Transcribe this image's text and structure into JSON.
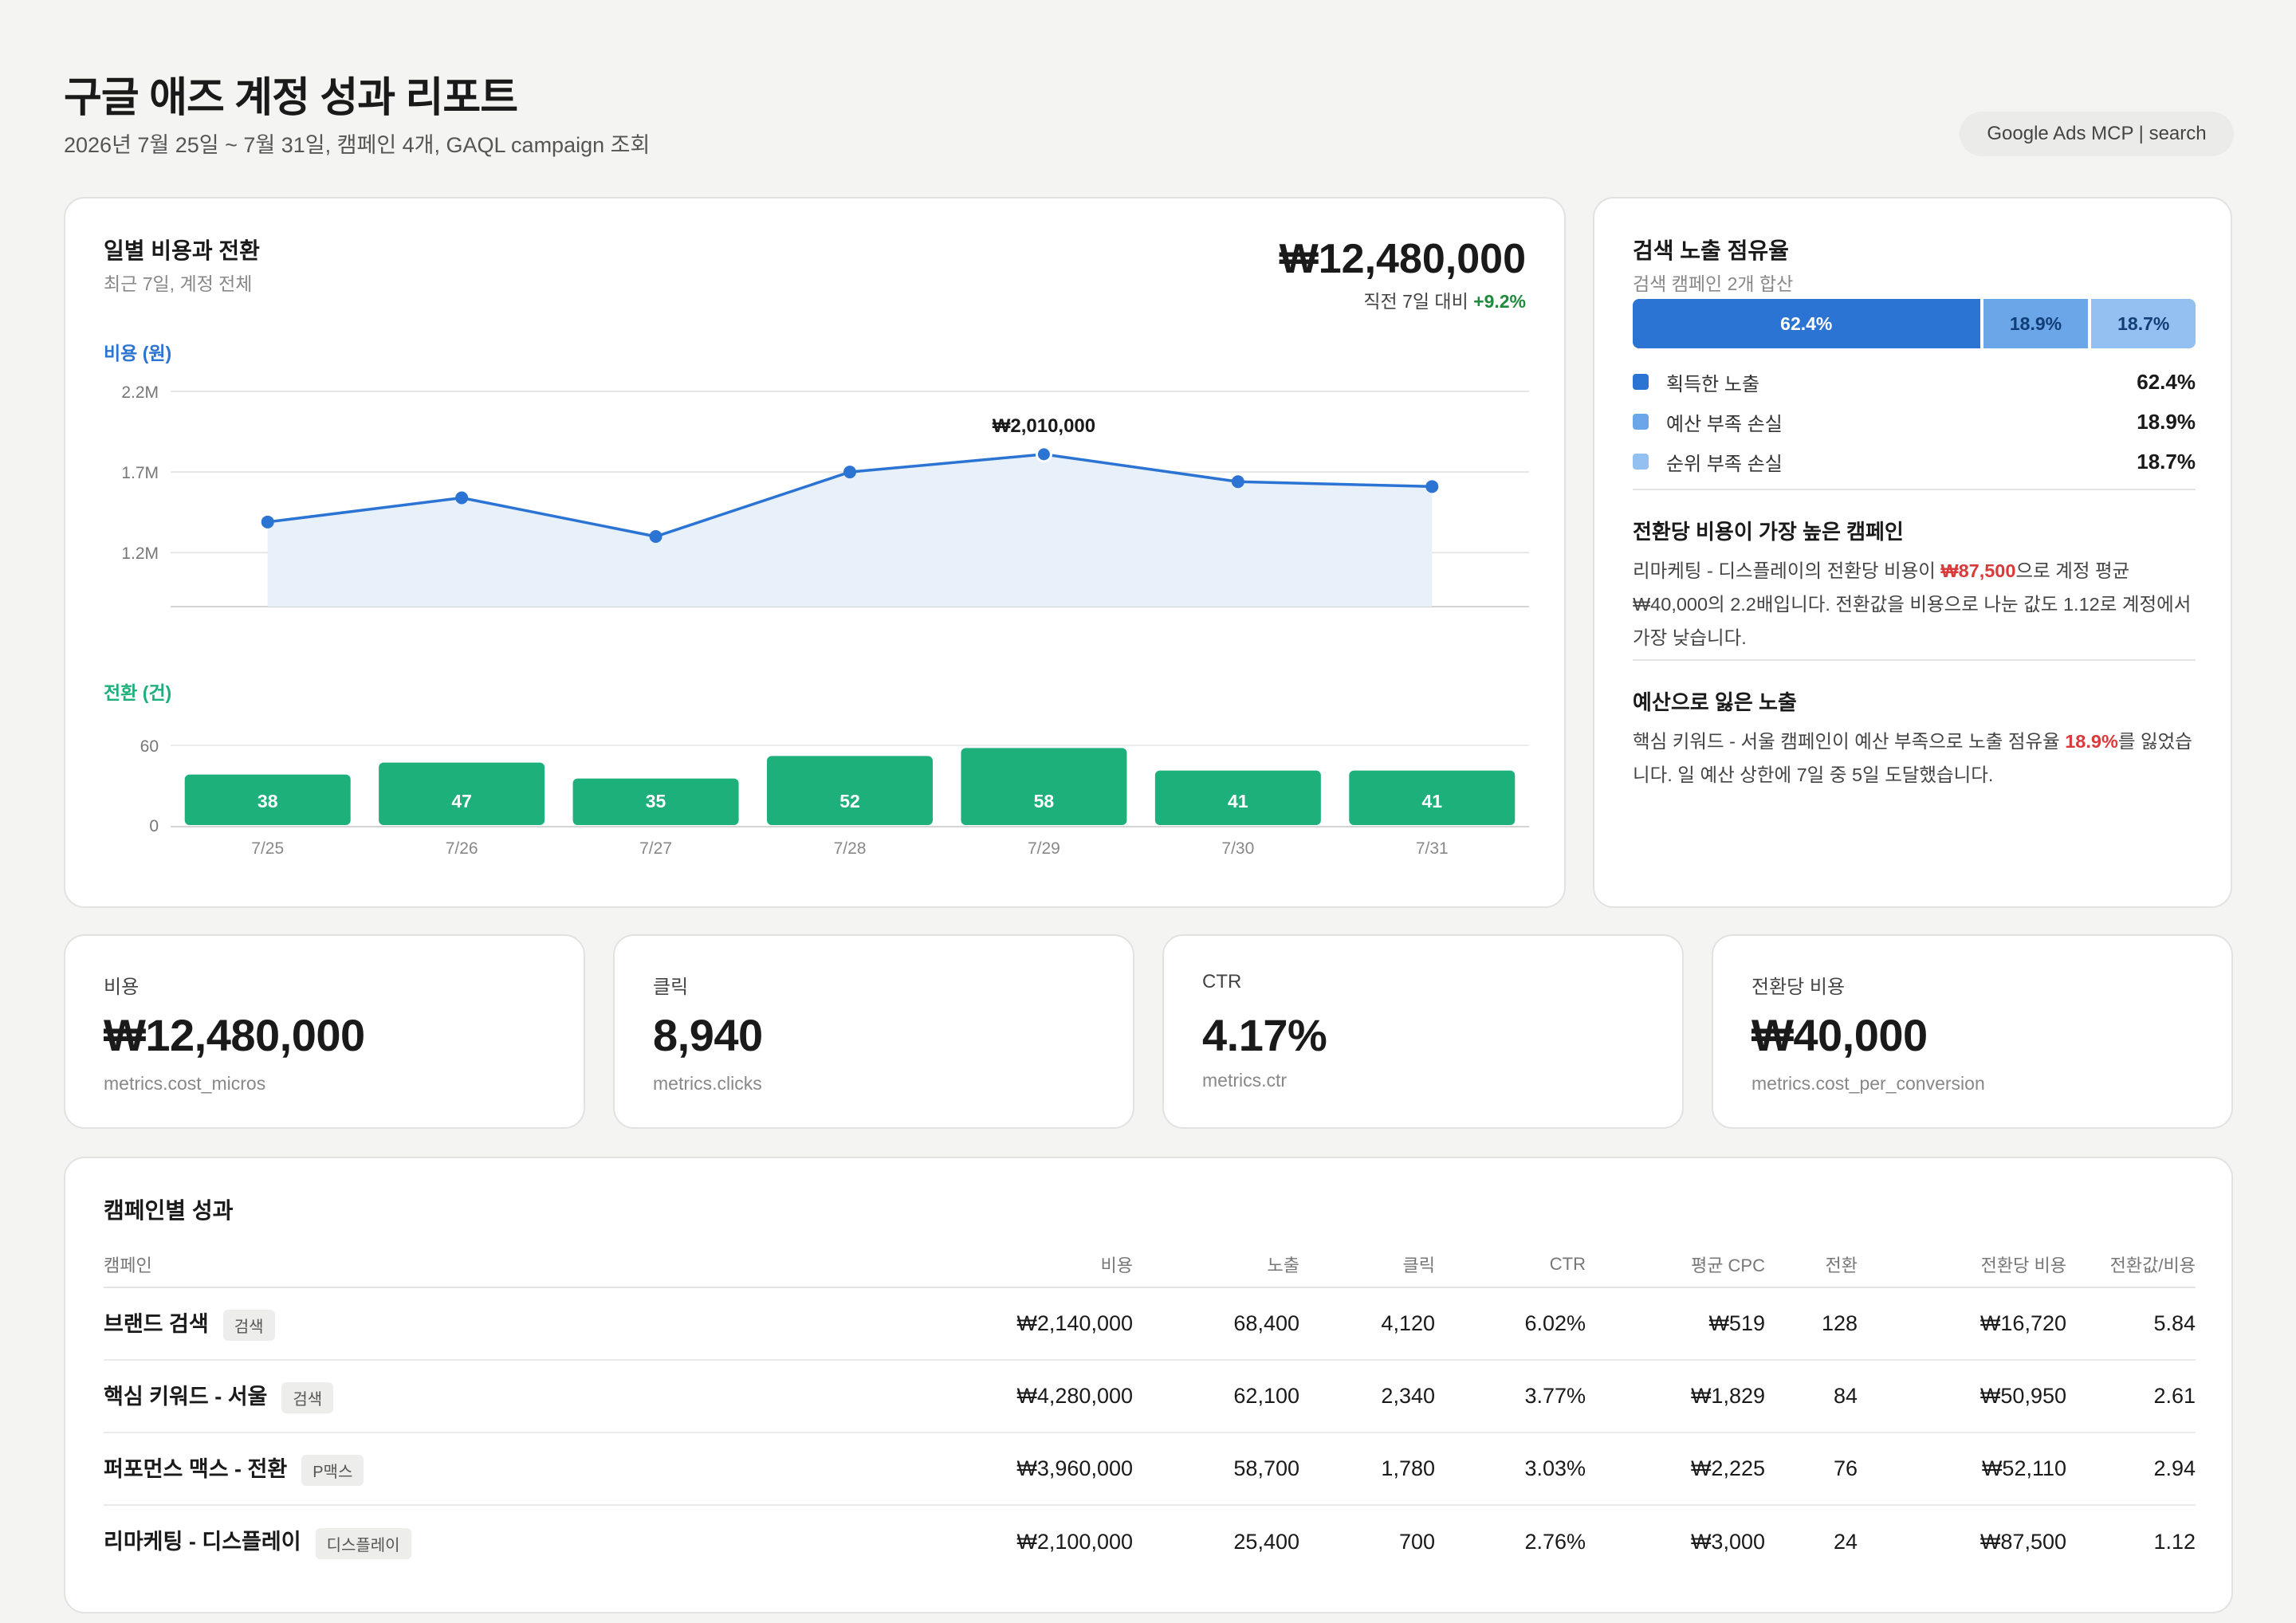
{
  "header": {
    "title": "구글 애즈 계정 성과 리포트",
    "subtitle": "2026년 7월 25일 ~ 7월 31일, 캠페인 4개, GAQL campaign 조회",
    "source": "Google Ads MCP | search"
  },
  "daily": {
    "title": "일별 비용과 전환",
    "subtitle": "최근 7일, 계정 전체",
    "total": "₩12,480,000",
    "delta_prefix": "직전 7일 대비",
    "delta_value": "+9.2%",
    "cost_axis_label": "비용 (원)",
    "conv_axis_label": "전환 (건)",
    "peak_label": "₩2,010,000"
  },
  "chart_data": [
    {
      "type": "line",
      "ylabel": "비용 (원)",
      "x": [
        "7/25",
        "7/26",
        "7/27",
        "7/28",
        "7/29",
        "7/30",
        "7/31"
      ],
      "values": [
        1390000,
        1540000,
        1300000,
        1700000,
        1810000,
        1640000,
        1610000
      ],
      "yticks": [
        "1.2M",
        "1.7M",
        "2.2M"
      ],
      "ylim": [
        865000,
        2200000
      ],
      "annotation": "₩2,010,000",
      "area_fill": true,
      "color": "#2b74d3"
    },
    {
      "type": "bar",
      "ylabel": "전환 (건)",
      "categories": [
        "7/25",
        "7/26",
        "7/27",
        "7/28",
        "7/29",
        "7/30",
        "7/31"
      ],
      "values": [
        38,
        47,
        35,
        52,
        58,
        41,
        41
      ],
      "yticks": [
        "0",
        "60"
      ],
      "ylim": [
        0,
        60
      ],
      "color": "#1eb07a"
    }
  ],
  "share": {
    "title": "검색 노출 점유율",
    "subtitle": "검색 캠페인 2개 합산",
    "segments": [
      {
        "label": "획득한 노출",
        "value": 62.4,
        "text": "62.4%",
        "color": "#2b74d3",
        "text_color": "#ffffff"
      },
      {
        "label": "예산 부족 손실",
        "value": 18.9,
        "text": "18.9%",
        "color": "#6aa6e8",
        "text_color": "#123e77"
      },
      {
        "label": "순위 부족 손실",
        "value": 18.7,
        "text": "18.7%",
        "color": "#93c0f0",
        "text_color": "#123e77"
      }
    ],
    "insight1": {
      "title": "전환당 비용이 가장 높은 캠페인",
      "pre": "리마케팅 - 디스플레이의 전환당 비용이 ",
      "highlight": "₩87,500",
      "post": "으로 계정 평균 ₩40,000의 2.2배입니다. 전환값을 비용으로 나눈 값도 1.12로 계정에서 가장 낮습니다."
    },
    "insight2": {
      "title": "예산으로 잃은 노출",
      "pre": "핵심 키워드 - 서울 캠페인이 예산 부족으로 노출 점유율 ",
      "highlight": "18.9%",
      "post": "를 잃었습니다. 일 예산 상한에 7일 중 5일 도달했습니다."
    }
  },
  "kpis": [
    {
      "label": "비용",
      "value": "₩12,480,000",
      "field": "metrics.cost_micros"
    },
    {
      "label": "클릭",
      "value": "8,940",
      "field": "metrics.clicks"
    },
    {
      "label": "CTR",
      "value": "4.17%",
      "field": "metrics.ctr"
    },
    {
      "label": "전환당 비용",
      "value": "₩40,000",
      "field": "metrics.cost_per_conversion"
    }
  ],
  "campaigns": {
    "title": "캠페인별 성과",
    "columns": [
      "캠페인",
      "비용",
      "노출",
      "클릭",
      "CTR",
      "평균 CPC",
      "전환",
      "전환당 비용",
      "전환값/비용"
    ],
    "rows": [
      {
        "name": "브랜드 검색",
        "tag": "검색",
        "cost": "₩2,140,000",
        "impr": "68,400",
        "clicks": "4,120",
        "ctr": "6.02%",
        "cpc": "₩519",
        "conv": "128",
        "cpa": "₩16,720",
        "roas": "5.84"
      },
      {
        "name": "핵심 키워드 - 서울",
        "tag": "검색",
        "cost": "₩4,280,000",
        "impr": "62,100",
        "clicks": "2,340",
        "ctr": "3.77%",
        "cpc": "₩1,829",
        "conv": "84",
        "cpa": "₩50,950",
        "roas": "2.61"
      },
      {
        "name": "퍼포먼스 맥스 - 전환",
        "tag": "P맥스",
        "cost": "₩3,960,000",
        "impr": "58,700",
        "clicks": "1,780",
        "ctr": "3.03%",
        "cpc": "₩2,225",
        "conv": "76",
        "cpa": "₩52,110",
        "roas": "2.94"
      },
      {
        "name": "리마케팅 - 디스플레이",
        "tag": "디스플레이",
        "cost": "₩2,100,000",
        "impr": "25,400",
        "clicks": "700",
        "ctr": "2.76%",
        "cpc": "₩3,000",
        "conv": "24",
        "cpa": "₩87,500",
        "roas": "1.12"
      }
    ]
  }
}
